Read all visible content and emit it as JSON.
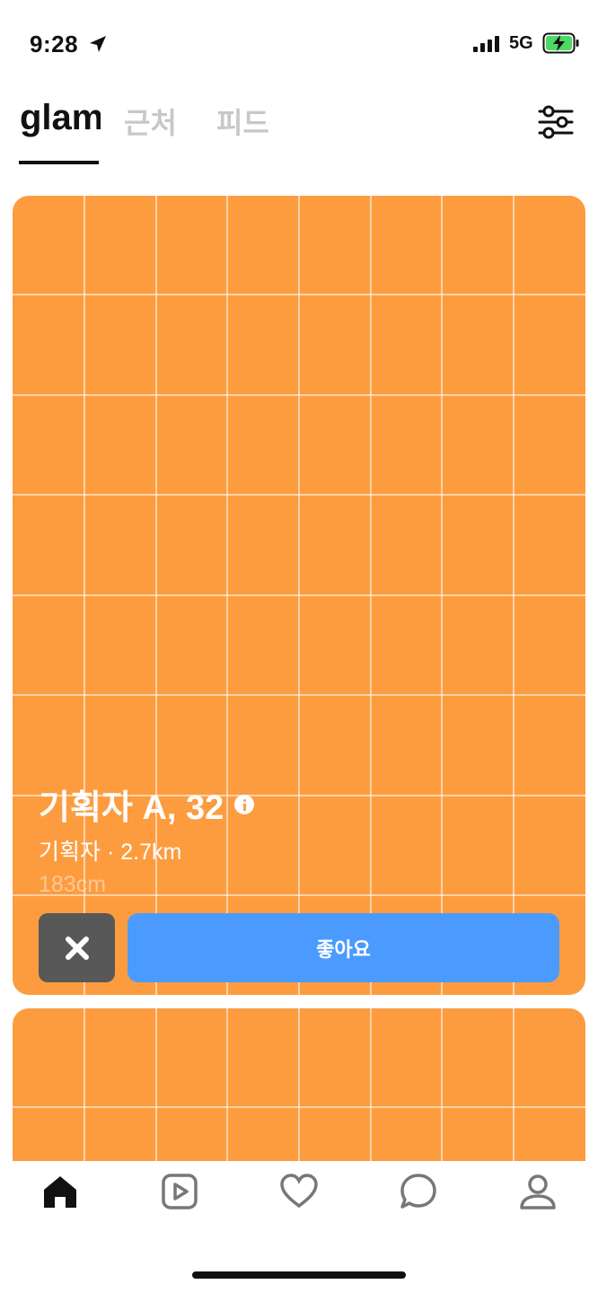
{
  "status_bar": {
    "time": "9:28",
    "network": "5G"
  },
  "header": {
    "logo_text": "glam",
    "tabs": [
      {
        "label": "근처"
      },
      {
        "label": "피드"
      }
    ]
  },
  "profile_card": {
    "name_age": "기획자 A, 32",
    "meta": "기획자 · 2.7km",
    "height": "183cm",
    "like_label": "좋아요"
  },
  "colors": {
    "card_background": "#fd9c3f",
    "like_button": "#4b9bff",
    "pass_button": "#585858",
    "tab_inactive": "#c8c8c8"
  },
  "icons": {
    "status": [
      "location-arrow-icon",
      "signal-bars-icon",
      "battery-charging-icon"
    ],
    "header": [
      "filter-sliders-icon"
    ],
    "card": [
      "info-icon",
      "close-x-icon"
    ],
    "bottom_nav": [
      "home-icon",
      "video-play-icon",
      "heart-icon",
      "chat-bubble-icon",
      "profile-icon"
    ]
  }
}
